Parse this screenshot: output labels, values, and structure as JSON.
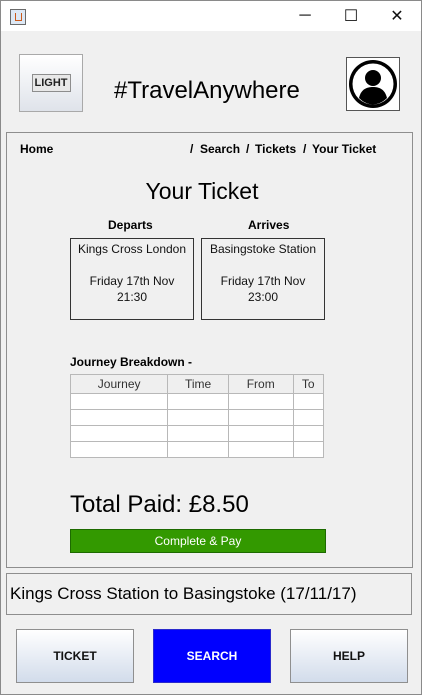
{
  "window": {
    "controls": {
      "minimize": "─",
      "maximize": "☐",
      "close": "✕"
    }
  },
  "header": {
    "light_label": "LIGHT",
    "brand": "#TravelAnywhere",
    "avatar_icon": "user-profile-icon"
  },
  "nav": {
    "home": "Home",
    "sep1": "/",
    "search": "Search",
    "sep2": "/",
    "tickets": "Tickets",
    "sep3": "/",
    "current": "Your Ticket"
  },
  "page_title": "Your Ticket",
  "departs": {
    "heading": "Departs",
    "station": "Kings Cross London",
    "date": "Friday 17th Nov",
    "time": "21:30"
  },
  "arrives": {
    "heading": "Arrives",
    "station": "Basingstoke Station",
    "date": "Friday 17th Nov",
    "time": "23:00"
  },
  "breakdown": {
    "title": "Journey Breakdown -",
    "columns": [
      "Journey",
      "Time",
      "From",
      "To"
    ],
    "rows": [
      [
        "",
        "",
        "",
        ""
      ],
      [
        "",
        "",
        "",
        ""
      ],
      [
        "",
        "",
        "",
        ""
      ],
      [
        "",
        "",
        "",
        ""
      ]
    ]
  },
  "total": "Total Paid: £8.50",
  "pay_button": "Complete & Pay",
  "summary": "Kings Cross Station to Basingstoke (17/11/17)",
  "bottom_nav": {
    "ticket": "TICKET",
    "search": "SEARCH",
    "help": "HELP"
  },
  "colors": {
    "pay_button": "#339900",
    "search_button": "#0000ff"
  }
}
